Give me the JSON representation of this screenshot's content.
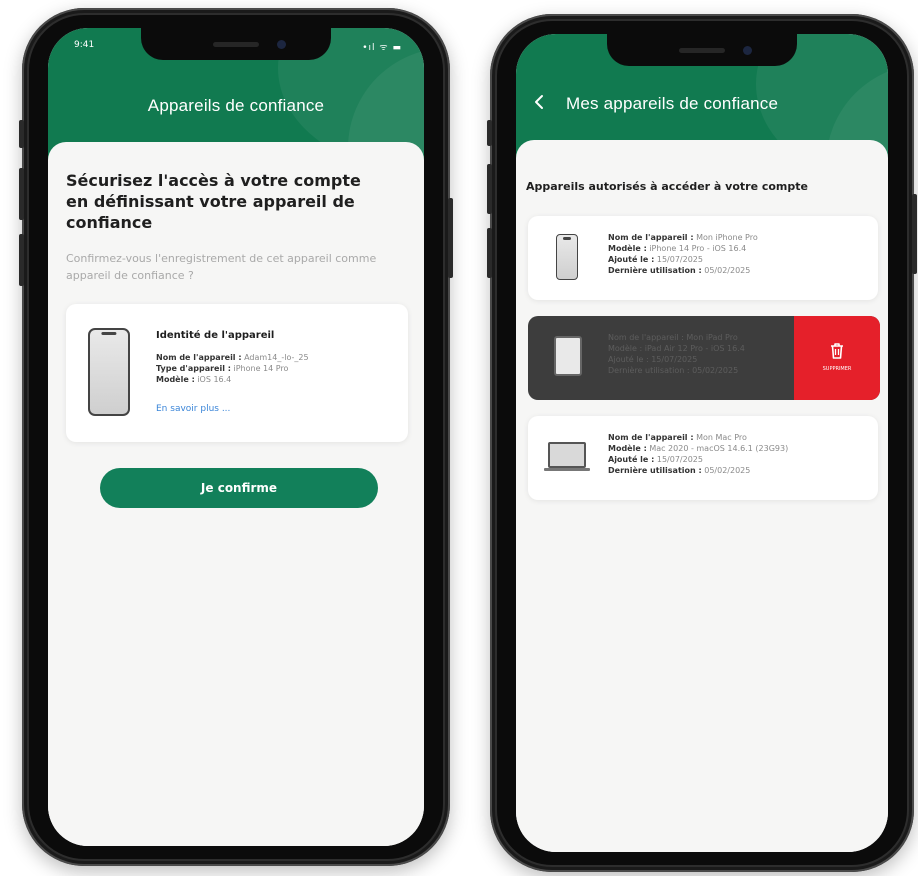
{
  "left_phone": {
    "status": {
      "time": "9:41",
      "icons": "•ıl ᯤ ▬"
    },
    "header_title": "Appareils de confiance",
    "heading": "Sécurisez l'accès à votre compte en définissant votre appareil de confiance",
    "subheading": "Confirmez-vous l'enregistrement de cet appareil comme appareil de confiance ?",
    "device_card": {
      "title": "Identité de l'appareil",
      "name_label": "Nom de l'appareil :",
      "name_value": "Adam14_-lo-_25",
      "type_label": "Type d'appareil :",
      "type_value": "iPhone 14 Pro",
      "model_label": "Modèle :",
      "model_value": "iOS 16.4",
      "more_link": "En savoir plus ..."
    },
    "confirm_button": "Je confirme"
  },
  "right_phone": {
    "back_icon": "chevron-left-icon",
    "header_title": "Mes appareils de confiance",
    "section_title": "Appareils autorisés à accéder à votre compte",
    "devices": [
      {
        "icon": "smartphone-icon",
        "name_label": "Nom de l'appareil :",
        "name_value": "Mon iPhone Pro",
        "model_label": "Modèle :",
        "model_value": "iPhone 14 Pro - iOS 16.4",
        "added_label": "Ajouté le :",
        "added_value": "15/07/2025",
        "last_label": "Dernière utilisation :",
        "last_value": "05/02/2025"
      },
      {
        "icon": "tablet-icon",
        "name_label": "Nom de l'appareil :",
        "name_value": "Mon iPad Pro",
        "model_label": "Modèle :",
        "model_value": "iPad Air 12 Pro - iOS 16.4",
        "added_label": "Ajouté le :",
        "added_value": "15/07/2025",
        "last_label": "Dernière utilisation :",
        "last_value": "05/02/2025",
        "delete_label": "SUPPRIMER"
      },
      {
        "icon": "laptop-icon",
        "name_label": "Nom de l'appareil :",
        "name_value": "Mon Mac Pro",
        "model_label": "Modèle :",
        "model_value": "Mac 2020 - macOS 14.6.1 (23G93)",
        "added_label": "Ajouté le :",
        "added_value": "15/07/2025",
        "last_label": "Dernière utilisation :",
        "last_value": "05/02/2025"
      }
    ]
  },
  "colors": {
    "brand_green": "#117a50",
    "button_green": "#12805a",
    "delete_red": "#e5202a",
    "link_blue": "#3a85d8"
  }
}
